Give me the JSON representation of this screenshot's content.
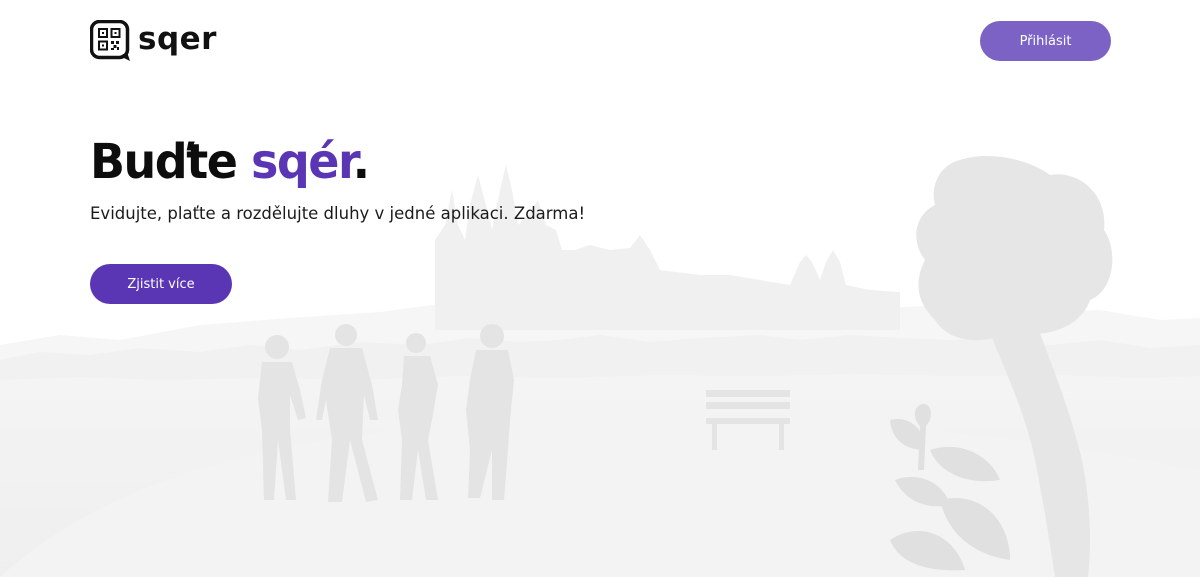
{
  "brand": {
    "name": "sqer",
    "logo_icon": "qr-code-icon",
    "accent_color": "#5a36b4",
    "login_color": "#7b62c4"
  },
  "header": {
    "login_label": "Přihlásit"
  },
  "hero": {
    "headline_prefix": "Buďte ",
    "headline_accent": "sqér",
    "headline_suffix": ".",
    "subtitle": "Evidujte, plaťte a rozdělujte dluhy v jedné aplikaci. Zdarma!",
    "cta_label": "Zjistit více"
  }
}
